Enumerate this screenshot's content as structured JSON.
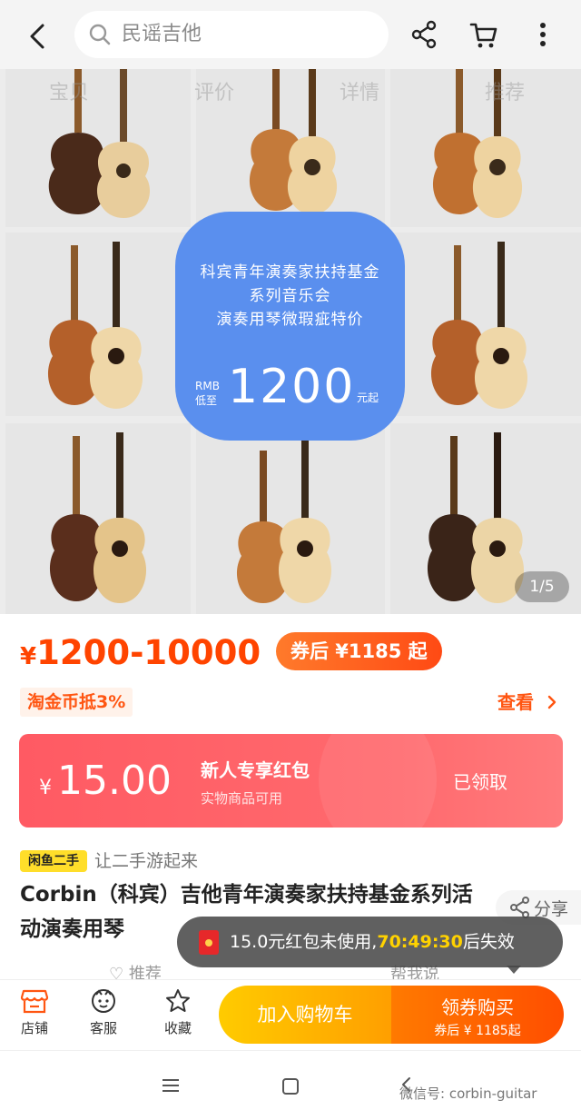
{
  "header": {
    "search_placeholder": "民谣吉他",
    "icons": [
      "back-arrow-icon",
      "search-icon",
      "share-icon",
      "cart-icon",
      "more-icon"
    ]
  },
  "gallery": {
    "ghost_tabs": [
      "宝贝",
      "评价",
      "详情",
      "推荐"
    ],
    "promo": {
      "line1": "科宾青年演奏家扶持基金",
      "line2": "系列音乐会",
      "line3": "演奏用琴微瑕疵特价",
      "rmb_label": "RMB",
      "low_label": "低至",
      "price": "1200",
      "suffix": "元起",
      "color": "#5a8fee"
    },
    "counter": "1/5"
  },
  "price": {
    "currency": "¥",
    "range": "1200-10000",
    "coupon_price": "券后 ¥1185 起",
    "accent_color": "#ff4400"
  },
  "tao_coin": "淘金币抵3%",
  "view_more": "查看",
  "red_packet": {
    "currency": "¥",
    "amount": "15.00",
    "title": "新人专享红包",
    "subtitle": "实物商品可用",
    "status": "已领取"
  },
  "product": {
    "xianyu_badge": "闲鱼二手",
    "xianyu_text": "让二手游起来",
    "title": "Corbin（科宾）吉他青年演奏家扶持基金系列活动演奏用琴",
    "share": "分享",
    "recommend": "推荐",
    "help_me_say": "帮我说"
  },
  "toast": {
    "prefix": "15.0元红包未使用,",
    "countdown": "70:49:30",
    "suffix": "后失效"
  },
  "bottom_bar": {
    "shop": "店铺",
    "service": "客服",
    "favorite": "收藏",
    "add_to_cart": "加入购物车",
    "buy": "领券购买",
    "buy_sub": "券后 ¥ 1185起"
  },
  "watermark": "微信号: corbin-guitar"
}
